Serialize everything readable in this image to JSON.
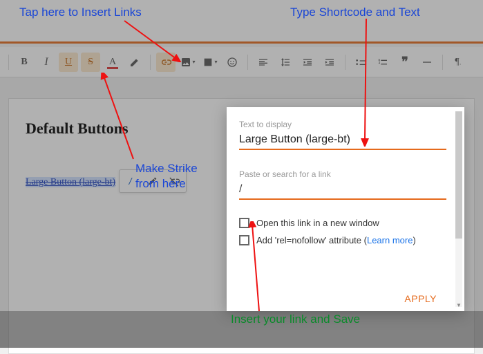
{
  "annotations": {
    "tap_insert": "Tap here to Insert Links",
    "type_shortcode": "Type Shortcode and Text",
    "make_strike": "Make Strike",
    "from_here": "from here",
    "insert_save": "Insert your link and Save"
  },
  "toolbar": {
    "bold": "B",
    "italic": "I",
    "underline": "U",
    "strike": "S",
    "textcolor": "A"
  },
  "editor": {
    "heading": "Default Buttons",
    "selected_text": "Large Button (large-bt)",
    "mini_slash": "/"
  },
  "popover": {
    "text_label": "Text to display",
    "text_value": "Large Button (large-bt)",
    "link_label": "Paste or search for a link",
    "link_value": "/",
    "newwindow_label": "Open this link in a new window",
    "nofollow_label": "Add 'rel=nofollow' attribute (",
    "learn_more": "Learn more",
    "nofollow_close": ")",
    "apply": "APPLY"
  }
}
